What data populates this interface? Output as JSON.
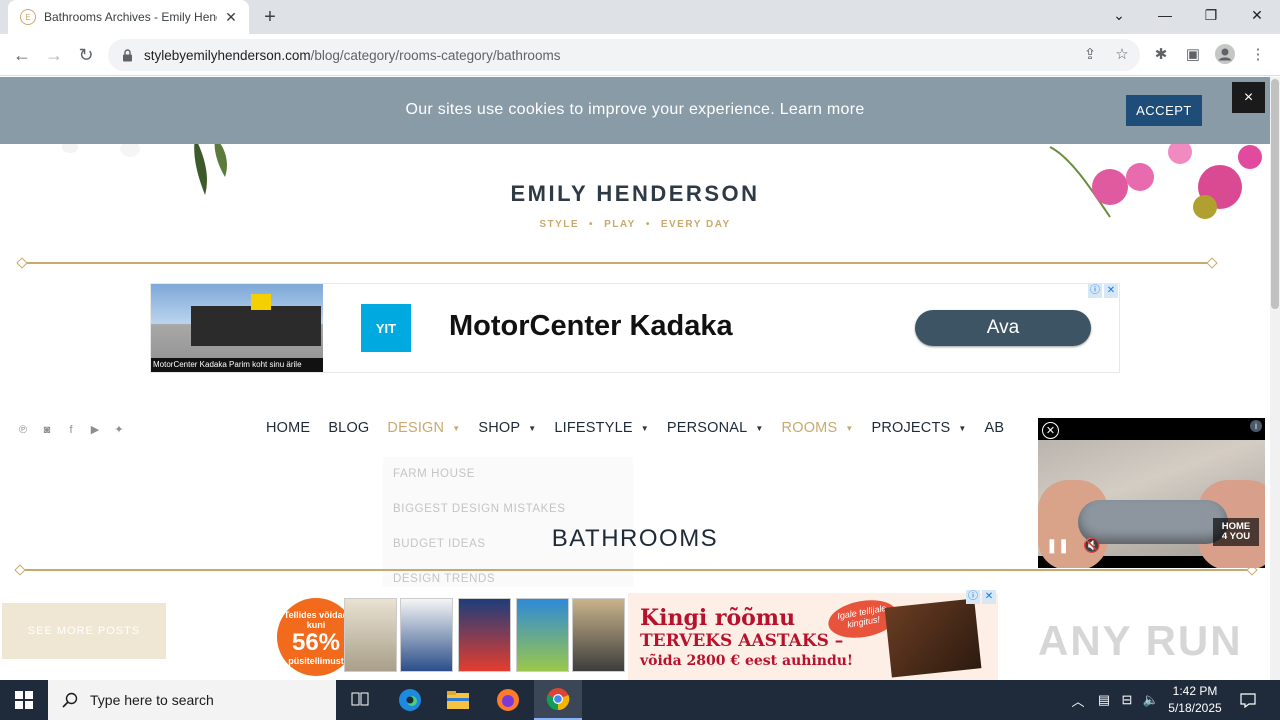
{
  "browser": {
    "tab_title": "Bathrooms Archives - Emily Henderson",
    "new_tab": "+",
    "url_domain": "stylebyemilyhenderson.com",
    "url_path": "/blog/category/rooms-category/bathrooms"
  },
  "cookie_banner": {
    "message": "Our sites use cookies to improve your experience. Learn more",
    "accept_label": "ACCEPT",
    "close_label": "×"
  },
  "header": {
    "brand_name": "EMILY HENDERSON",
    "tagline": [
      "STYLE",
      "PLAY",
      "EVERY DAY"
    ],
    "tagline_separator": "•"
  },
  "ad_top": {
    "image_caption": "MotorCenter Kadaka Parim koht sinu ärile",
    "logo_text": "YIT",
    "headline": "MotorCenter Kadaka",
    "cta_label": "Ava"
  },
  "social": {
    "icons": [
      "pinterest-icon",
      "instagram-icon",
      "facebook-icon",
      "youtube-icon",
      "twitter-icon"
    ]
  },
  "nav": {
    "items": [
      {
        "label": "HOME",
        "dropdown": false,
        "active": false
      },
      {
        "label": "BLOG",
        "dropdown": false,
        "active": false
      },
      {
        "label": "DESIGN",
        "dropdown": true,
        "active": true
      },
      {
        "label": "SHOP",
        "dropdown": true,
        "active": false
      },
      {
        "label": "LIFESTYLE",
        "dropdown": true,
        "active": false
      },
      {
        "label": "PERSONAL",
        "dropdown": true,
        "active": false
      },
      {
        "label": "ROOMS",
        "dropdown": true,
        "active": true
      },
      {
        "label": "PROJECTS",
        "dropdown": true,
        "active": false
      },
      {
        "label": "AB",
        "dropdown": false,
        "active": false
      }
    ]
  },
  "design_dropdown": {
    "options": [
      "FARM HOUSE",
      "BIGGEST DESIGN MISTAKES",
      "BUDGET IDEAS",
      "DESIGN TRENDS"
    ]
  },
  "page_heading": "BATHROOMS",
  "video": {
    "brand_line1": "HOME",
    "brand_line2": "4 YOU",
    "info": "i"
  },
  "see_more": "SEE MORE POSTS",
  "ad_bottom": {
    "badge_top": "Tellides võidad kuni",
    "badge_pct": "56%",
    "badge_bottom": "püsitellimust",
    "line1": "Kingi rõõmu",
    "line2": "TERVEKS AASTAKS –",
    "line3": "võida 2800 € eest auhindu!",
    "sticker": "Igale tellijale kingitus!"
  },
  "watermark": "ANY RUN",
  "taskbar": {
    "search_placeholder": "Type here to search",
    "time": "1:42 PM",
    "date": "5/18/2025"
  },
  "colors": {
    "accent_gold": "#c9a96e",
    "cookie_bg": "#8a9ba8",
    "accept_bg": "#1e4d7a",
    "nav_text": "#1f2a36"
  }
}
